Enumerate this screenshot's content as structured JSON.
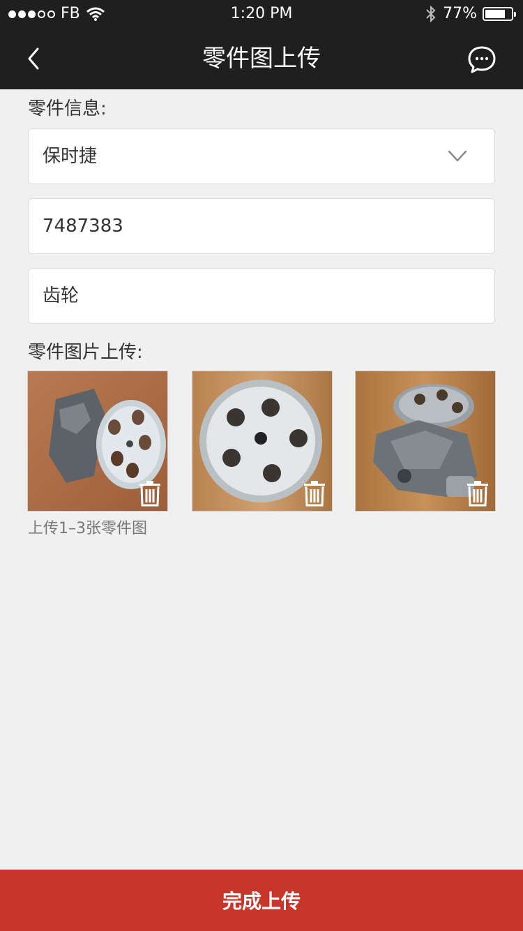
{
  "status_bar": {
    "carrier": "FB",
    "time": "1:20 PM",
    "battery_percent": "77%",
    "battery_level": 0.77
  },
  "nav": {
    "title": "零件图上传",
    "back_icon": "chevron-left-icon",
    "right_icon": "chat-bubble-icon"
  },
  "form": {
    "info_label": "零件信息:",
    "brand_select": "保时捷",
    "part_number": "7487383",
    "part_name": "齿轮",
    "images_label": "零件图片上传:",
    "hint": "上传1–3张零件图"
  },
  "images": [
    {
      "name": "part-photo-1",
      "delete_icon": "trash-icon"
    },
    {
      "name": "part-photo-2",
      "delete_icon": "trash-icon"
    },
    {
      "name": "part-photo-3",
      "delete_icon": "trash-icon"
    }
  ],
  "submit_label": "完成上传",
  "colors": {
    "header": "#1f1f1f",
    "accent": "#c8362b",
    "background": "#f0f0f0"
  }
}
